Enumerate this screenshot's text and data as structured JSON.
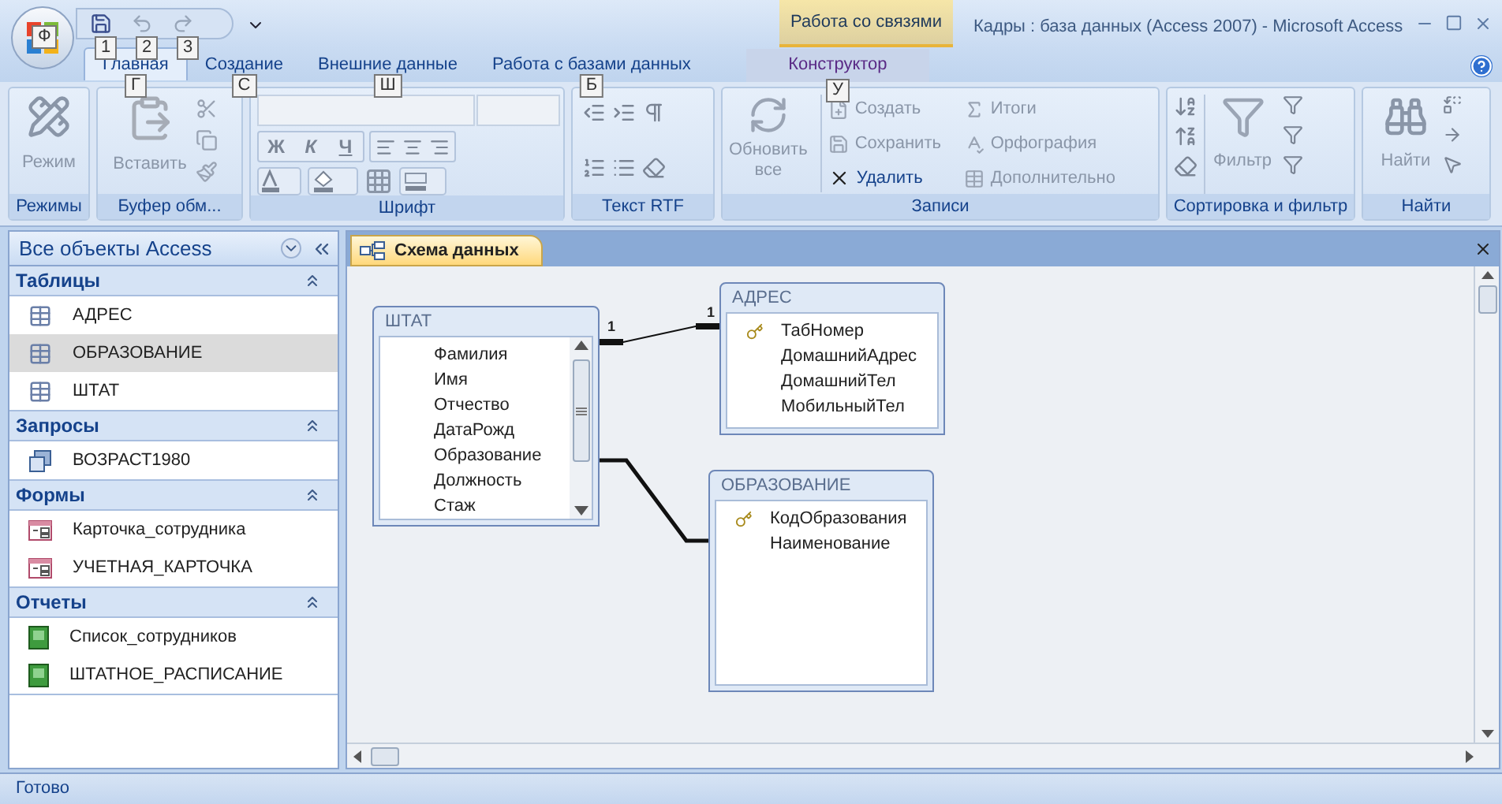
{
  "window": {
    "title": "Кадры : база данных (Access 2007) - Microsoft Access"
  },
  "app_button": {
    "keytip": "Ф"
  },
  "quick_access": [
    {
      "kind": "save",
      "keytip": "1"
    },
    {
      "kind": "undo",
      "keytip": "2"
    },
    {
      "kind": "redo",
      "keytip": "3"
    }
  ],
  "context_tab_group": "Работа со связями",
  "tabs": [
    {
      "label": "Главная",
      "selected": true,
      "keytip": "Г"
    },
    {
      "label": "Создание",
      "selected": false,
      "keytip": "С"
    },
    {
      "label": "Внешние данные",
      "selected": false,
      "keytip": "Ш"
    },
    {
      "label": "Работа с базами данных",
      "selected": false,
      "keytip": "Б"
    },
    {
      "label": "Конструктор",
      "selected": false,
      "keytip": "У",
      "contextual": true
    }
  ],
  "ribbon": {
    "modes": {
      "title": "Режимы",
      "button": "Режим"
    },
    "clipboard": {
      "title": "Буфер обм...",
      "button": "Вставить"
    },
    "font": {
      "title": "Шрифт",
      "styles": [
        "Ж",
        "К",
        "Ч"
      ]
    },
    "rtf": {
      "title": "Текст RTF"
    },
    "records": {
      "title": "Записи",
      "refresh": [
        "Обновить",
        "все"
      ],
      "buttons": [
        {
          "label": "Создать",
          "kind": "new",
          "disabled": true
        },
        {
          "label": "Итоги",
          "kind": "sum",
          "disabled": true
        },
        {
          "label": "Сохранить",
          "kind": "save",
          "disabled": true
        },
        {
          "label": "Орфография",
          "kind": "spell",
          "disabled": true
        },
        {
          "label": "Удалить",
          "kind": "delete",
          "disabled": false
        },
        {
          "label": "Дополнительно",
          "kind": "more",
          "disabled": true
        }
      ]
    },
    "sort": {
      "title": "Сортировка и фильтр",
      "button": "Фильтр"
    },
    "find": {
      "title": "Найти",
      "button": "Найти"
    }
  },
  "nav": {
    "title": "Все объекты Access",
    "groups": [
      {
        "title": "Таблицы",
        "items": [
          {
            "label": "АДРЕС",
            "kind": "table",
            "selected": false
          },
          {
            "label": "ОБРАЗОВАНИЕ",
            "kind": "table",
            "selected": true
          },
          {
            "label": "ШТАТ",
            "kind": "table",
            "selected": false
          }
        ]
      },
      {
        "title": "Запросы",
        "items": [
          {
            "label": "ВОЗРАСТ1980",
            "kind": "query",
            "selected": false
          }
        ]
      },
      {
        "title": "Формы",
        "items": [
          {
            "label": "Карточка_сотрудника",
            "kind": "form",
            "selected": false
          },
          {
            "label": "УЧЕТНАЯ_КАРТОЧКА",
            "kind": "form",
            "selected": false
          }
        ]
      },
      {
        "title": "Отчеты",
        "items": [
          {
            "label": "Список_сотрудников",
            "kind": "report",
            "selected": false
          },
          {
            "label": "ШТАТНОЕ_РАСПИСАНИЕ",
            "kind": "report",
            "selected": false
          }
        ]
      }
    ]
  },
  "document_tab": "Схема данных",
  "diagram": {
    "tables": [
      {
        "title": "ШТАТ",
        "scroll": true,
        "fields": [
          {
            "name": "Фамилия",
            "key": false
          },
          {
            "name": "Имя",
            "key": false
          },
          {
            "name": "Отчество",
            "key": false
          },
          {
            "name": "ДатаРожд",
            "key": false
          },
          {
            "name": "Образование",
            "key": false
          },
          {
            "name": "Должность",
            "key": false
          },
          {
            "name": "Стаж",
            "key": false
          }
        ]
      },
      {
        "title": "АДРЕС",
        "scroll": false,
        "fields": [
          {
            "name": "ТабНомер",
            "key": true
          },
          {
            "name": "ДомашнийАдрес",
            "key": false
          },
          {
            "name": "ДомашнийТел",
            "key": false
          },
          {
            "name": "МобильныйТел",
            "key": false
          }
        ]
      },
      {
        "title": "ОБРАЗОВАНИЕ",
        "scroll": false,
        "fields": [
          {
            "name": "КодОбразования",
            "key": true
          },
          {
            "name": "Наименование",
            "key": false
          }
        ]
      }
    ],
    "relations": [
      {
        "kind": "labeled",
        "from_label": "1",
        "to_label": "1"
      },
      {
        "kind": "plain"
      }
    ]
  },
  "status_bar": "Готово"
}
